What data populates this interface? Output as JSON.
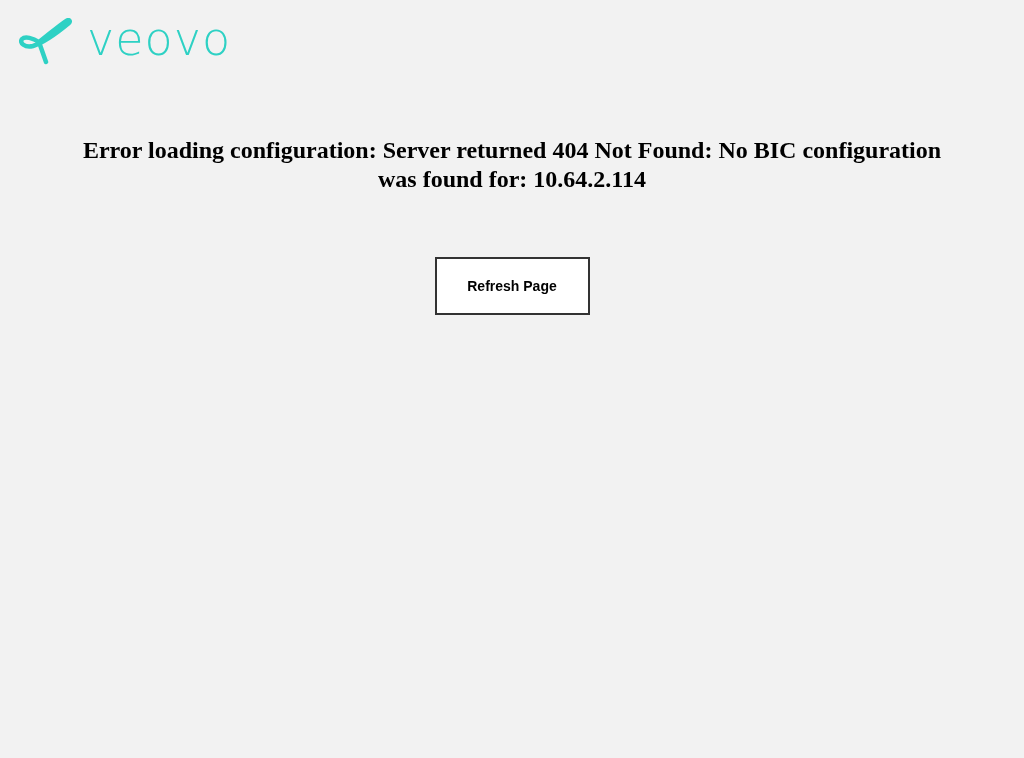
{
  "logo": {
    "text": "veovo"
  },
  "error": {
    "message": "Error loading configuration: Server returned 404 Not Found: No BIC configuration was found for: 10.64.2.114"
  },
  "buttons": [
    {
      "label": "Refresh Page"
    }
  ]
}
